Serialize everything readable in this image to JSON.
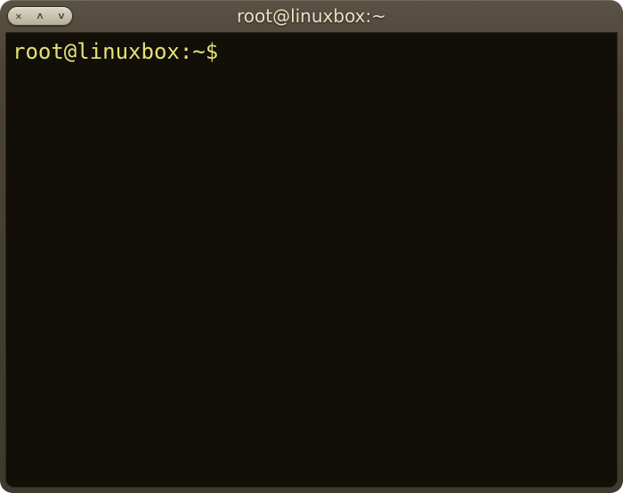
{
  "window": {
    "title": "root@linuxbox:~",
    "controls": {
      "close_glyph": "✕",
      "maximize_glyph": "˄",
      "minimize_glyph": "˅"
    }
  },
  "terminal": {
    "prompt": "root@linuxbox:~$ ",
    "command": ""
  },
  "colors": {
    "prompt_color": "#e6e17a",
    "terminal_bg": "#120f08",
    "frame_top": "#5a5244"
  }
}
